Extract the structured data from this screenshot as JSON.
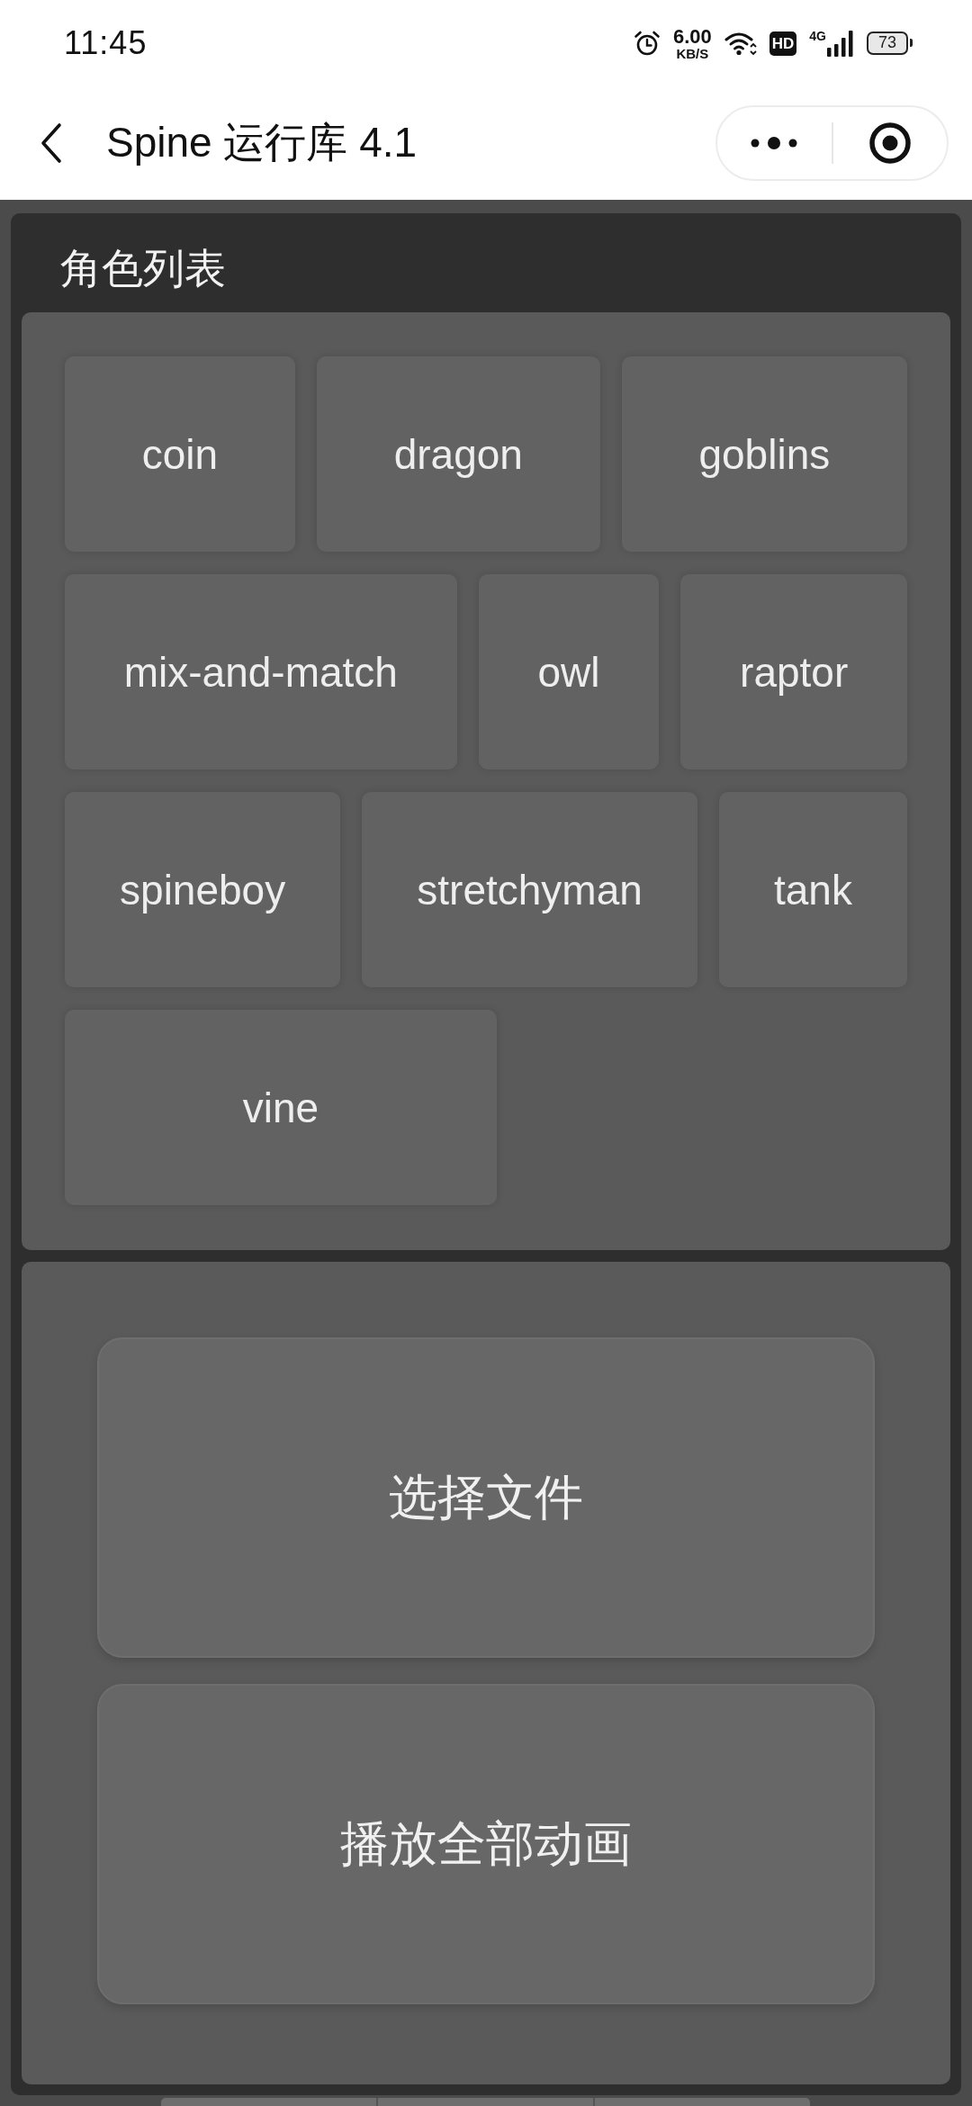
{
  "status_bar": {
    "time": "11:45",
    "network_speed": "6.00",
    "network_speed_unit": "KB/S",
    "hd_badge": "HD",
    "network_type": "4G",
    "battery": "73"
  },
  "nav_bar": {
    "title": "Spine 运行库 4.1"
  },
  "character_list": {
    "title": "角色列表",
    "characters": [
      "coin",
      "dragon",
      "goblins",
      "mix-and-match",
      "owl",
      "raptor",
      "spineboy",
      "stretchyman",
      "tank",
      "vine"
    ]
  },
  "actions": {
    "buttons": [
      "选择文件",
      "播放全部动画"
    ]
  }
}
